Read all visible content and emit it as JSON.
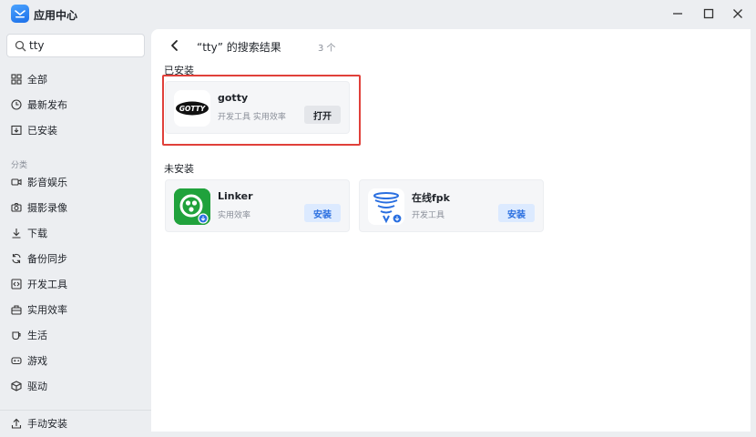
{
  "window": {
    "title": "应用中心"
  },
  "sidebar": {
    "search": {
      "value": "tty",
      "placeholder": ""
    },
    "top_items": [
      {
        "label": "全部",
        "icon": "grid-icon"
      },
      {
        "label": "最新发布",
        "icon": "clock-icon"
      },
      {
        "label": "已安装",
        "icon": "installed-box-icon"
      }
    ],
    "section_label": "分类",
    "categories": [
      {
        "label": "影音娱乐",
        "icon": "video-camera-icon"
      },
      {
        "label": "摄影录像",
        "icon": "camera-icon"
      },
      {
        "label": "下载",
        "icon": "download-icon"
      },
      {
        "label": "备份同步",
        "icon": "sync-icon"
      },
      {
        "label": "开发工具",
        "icon": "code-icon"
      },
      {
        "label": "实用效率",
        "icon": "toolbox-icon"
      },
      {
        "label": "生活",
        "icon": "cup-icon"
      },
      {
        "label": "游戏",
        "icon": "gamepad-icon"
      },
      {
        "label": "驱动",
        "icon": "cube-icon"
      }
    ],
    "bottom_item": {
      "label": "手动安装",
      "icon": "upload-icon"
    }
  },
  "main": {
    "result_title": "“tty” 的搜索结果",
    "result_count": "3 个",
    "installed_section": "已安装",
    "not_installed_section": "未安装",
    "installed_apps": [
      {
        "name": "gotty",
        "categories": "开发工具 实用效率",
        "button": "打开",
        "icon": "gotty-logo-icon"
      }
    ],
    "available_apps": [
      {
        "name": "Linker",
        "categories": "实用效率",
        "button": "安装",
        "icon": "linker-icon"
      },
      {
        "name": "在线fpk",
        "categories": "开发工具",
        "button": "安装",
        "icon": "funnel-icon"
      }
    ]
  },
  "colors": {
    "accent": "#2a6fe0",
    "highlight": "#e0403a"
  }
}
